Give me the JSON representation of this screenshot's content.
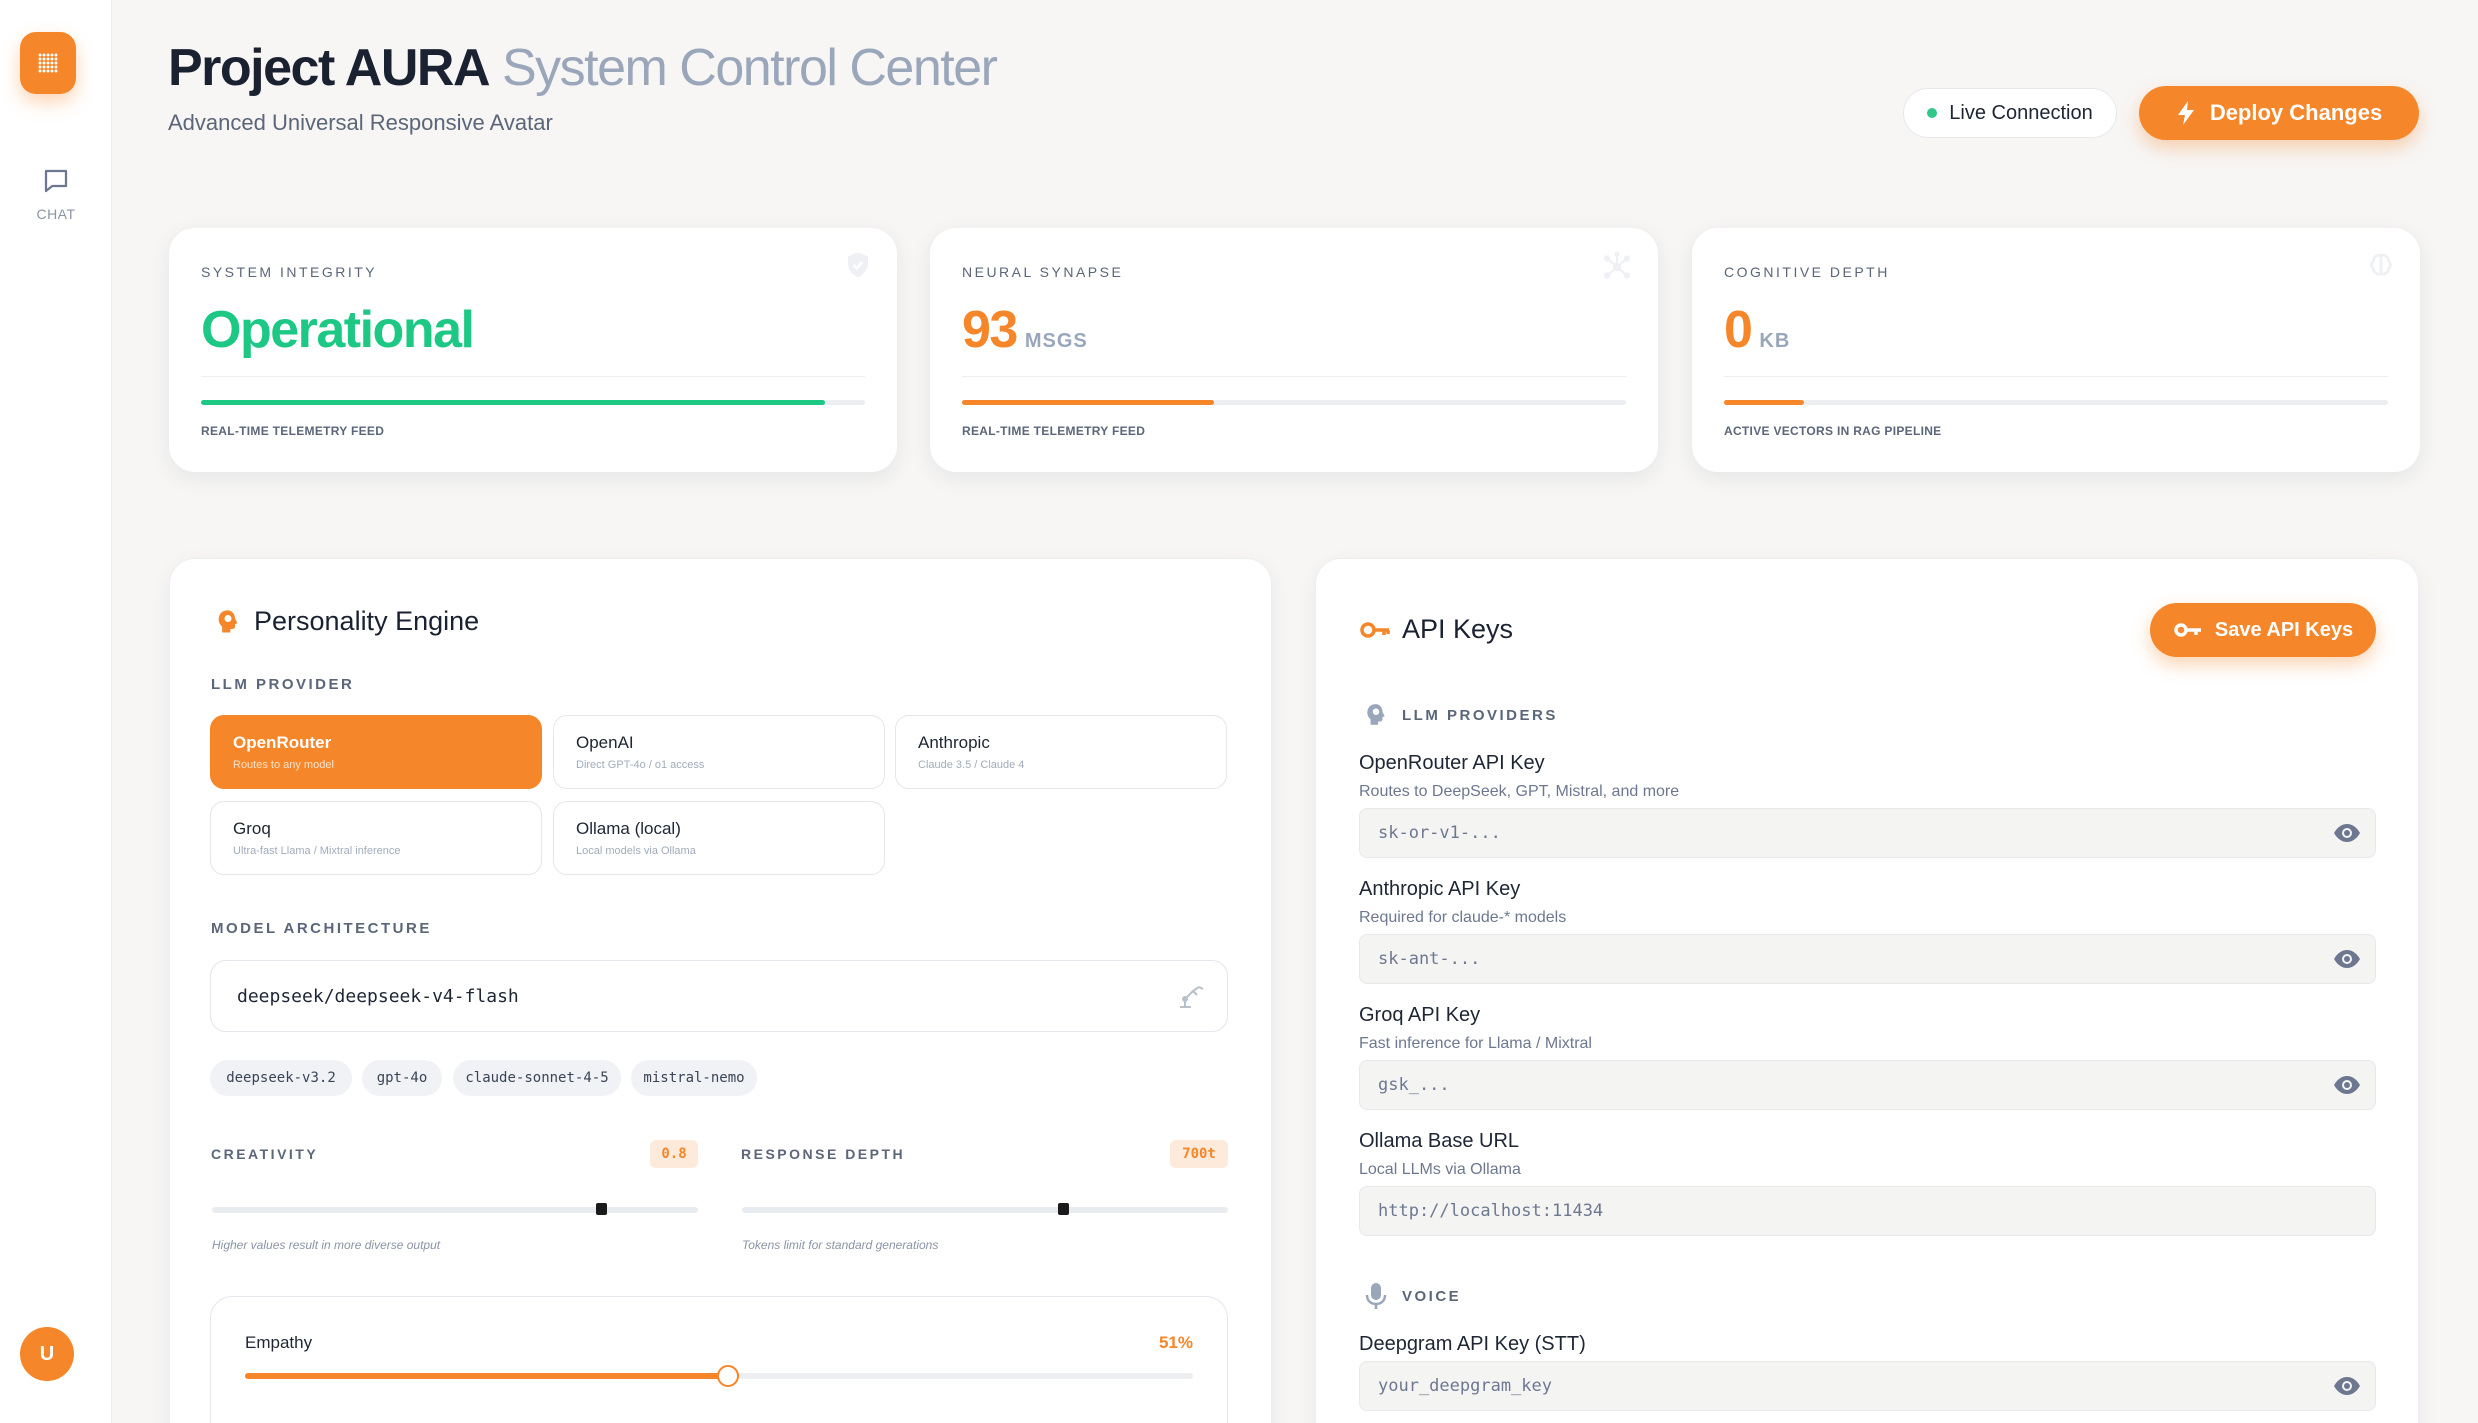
{
  "header": {
    "title_bold": "Project AURA",
    "title_light": "System Control Center",
    "subtitle": "Advanced Universal Responsive Avatar",
    "live_label": "Live Connection",
    "deploy_label": "Deploy Changes"
  },
  "sidebar": {
    "chat_label": "CHAT",
    "avatar_initial": "U"
  },
  "stats": [
    {
      "label": "SYSTEM INTEGRITY",
      "value": "Operational",
      "unit": "",
      "caption": "REAL-TIME TELEMETRY FEED",
      "progress": 0.94,
      "color": "#1dc784",
      "icon": "shield-icon"
    },
    {
      "label": "NEURAL SYNAPSE",
      "value": "93",
      "unit": "MSGS",
      "caption": "REAL-TIME TELEMETRY FEED",
      "progress": 0.38,
      "color": "#f6862a",
      "icon": "network-icon"
    },
    {
      "label": "COGNITIVE DEPTH",
      "value": "0",
      "unit": "KB",
      "caption": "ACTIVE VECTORS IN RAG PIPELINE",
      "progress": 0.12,
      "color": "#f6862a",
      "icon": "brain-icon"
    }
  ],
  "personality": {
    "title": "Personality Engine",
    "provider_section": "LLM PROVIDER",
    "providers": [
      {
        "name": "OpenRouter",
        "desc": "Routes to any model",
        "active": true
      },
      {
        "name": "OpenAI",
        "desc": "Direct GPT-4o / o1 access",
        "active": false
      },
      {
        "name": "Anthropic",
        "desc": "Claude 3.5 / Claude 4",
        "active": false
      },
      {
        "name": "Groq",
        "desc": "Ultra-fast Llama / Mixtral inference",
        "active": false
      },
      {
        "name": "Ollama (local)",
        "desc": "Local models via Ollama",
        "active": false
      }
    ],
    "model_section": "MODEL ARCHITECTURE",
    "model_value": "deepseek/deepseek-v4-flash",
    "model_chips": [
      "deepseek-v3.2",
      "gpt-4o",
      "claude-sonnet-4-5",
      "mistral-nemo"
    ],
    "creativity": {
      "label": "CREATIVITY",
      "value": "0.8",
      "level": 0.8,
      "help": "Higher values result in more diverse output"
    },
    "depth": {
      "label": "RESPONSE DEPTH",
      "value": "700t",
      "level": 0.66,
      "help": "Tokens limit for standard generations"
    },
    "empathy": {
      "label": "Empathy",
      "value": "51%",
      "level": 0.51
    }
  },
  "api_keys": {
    "title": "API Keys",
    "save_label": "Save API Keys",
    "llm_section": "LLM PROVIDERS",
    "voice_section": "VOICE",
    "keys": [
      {
        "label": "OpenRouter API Key",
        "help": "Routes to DeepSeek, GPT, Mistral, and more",
        "placeholder": "sk-or-v1-...",
        "secret": true
      },
      {
        "label": "Anthropic API Key",
        "help": "Required for claude-* models",
        "placeholder": "sk-ant-...",
        "secret": true
      },
      {
        "label": "Groq API Key",
        "help": "Fast inference for Llama / Mixtral",
        "placeholder": "gsk_...",
        "secret": true
      },
      {
        "label": "Ollama Base URL",
        "help": "Local LLMs via Ollama",
        "placeholder": "http://localhost:11434",
        "secret": false
      }
    ],
    "voice_keys": [
      {
        "label": "Deepgram API Key (STT)",
        "placeholder": "your_deepgram_key",
        "secret": true
      }
    ]
  },
  "colors": {
    "accent": "#f6862a",
    "success": "#1dc784",
    "text": "#1a2130",
    "muted": "#9aa7bb"
  }
}
